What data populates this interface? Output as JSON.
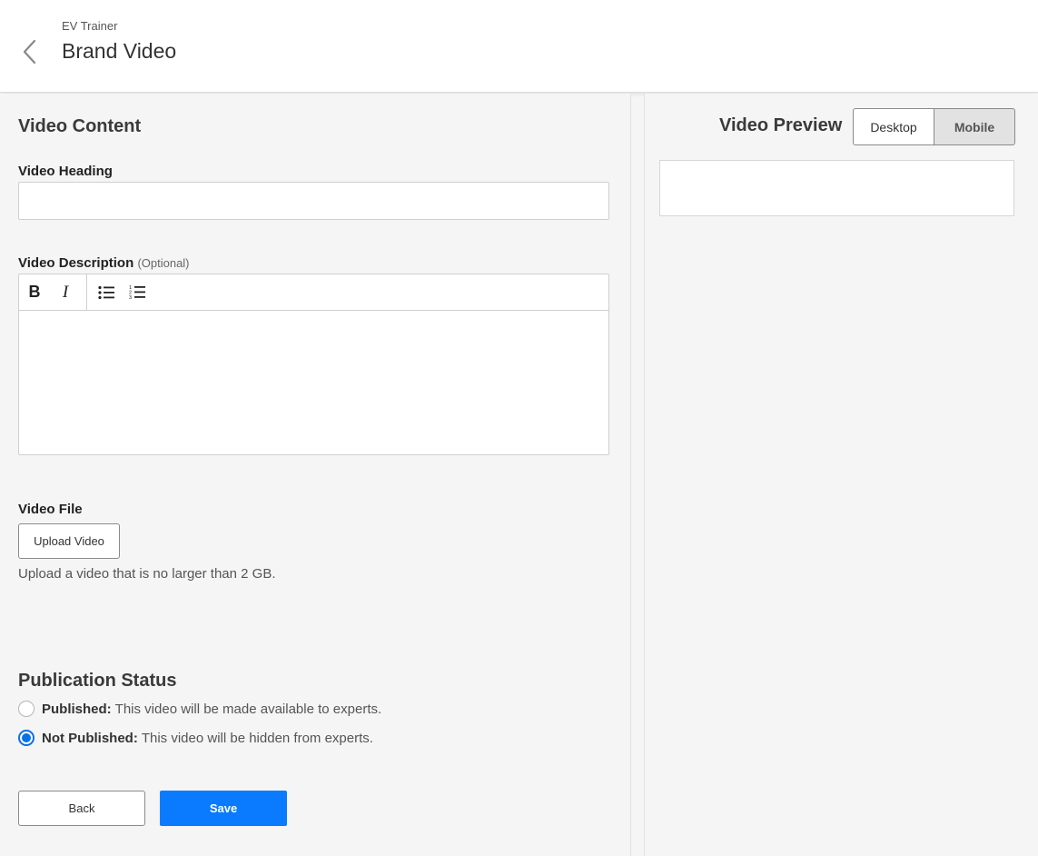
{
  "header": {
    "breadcrumb": "EV Trainer",
    "title": "Brand Video",
    "back_icon": "chevron-left-icon"
  },
  "content": {
    "section_title": "Video Content",
    "heading_label": "Video Heading",
    "heading_value": "",
    "description_label": "Video Description",
    "description_optional": "(Optional)",
    "toolbar": {
      "bold": "B",
      "italic": "I",
      "bullet_icon": "bulleted-list-icon",
      "numbered_icon": "numbered-list-icon"
    },
    "description_value": "",
    "file_label": "Video File",
    "upload_button": "Upload Video",
    "upload_hint": "Upload a video that is no larger than 2 GB."
  },
  "publication": {
    "title": "Publication Status",
    "options": [
      {
        "label": "Published:",
        "desc": "This video will be made available to experts.",
        "selected": false
      },
      {
        "label": "Not Published:",
        "desc": "This video will be hidden from experts.",
        "selected": true
      }
    ]
  },
  "actions": {
    "back_label": "Back",
    "save_label": "Save"
  },
  "preview": {
    "title": "Video Preview",
    "desktop_label": "Desktop",
    "mobile_label": "Mobile",
    "selected": "Mobile"
  },
  "colors": {
    "primary": "#0a7bff",
    "radio_selected": "#0a70e8"
  }
}
